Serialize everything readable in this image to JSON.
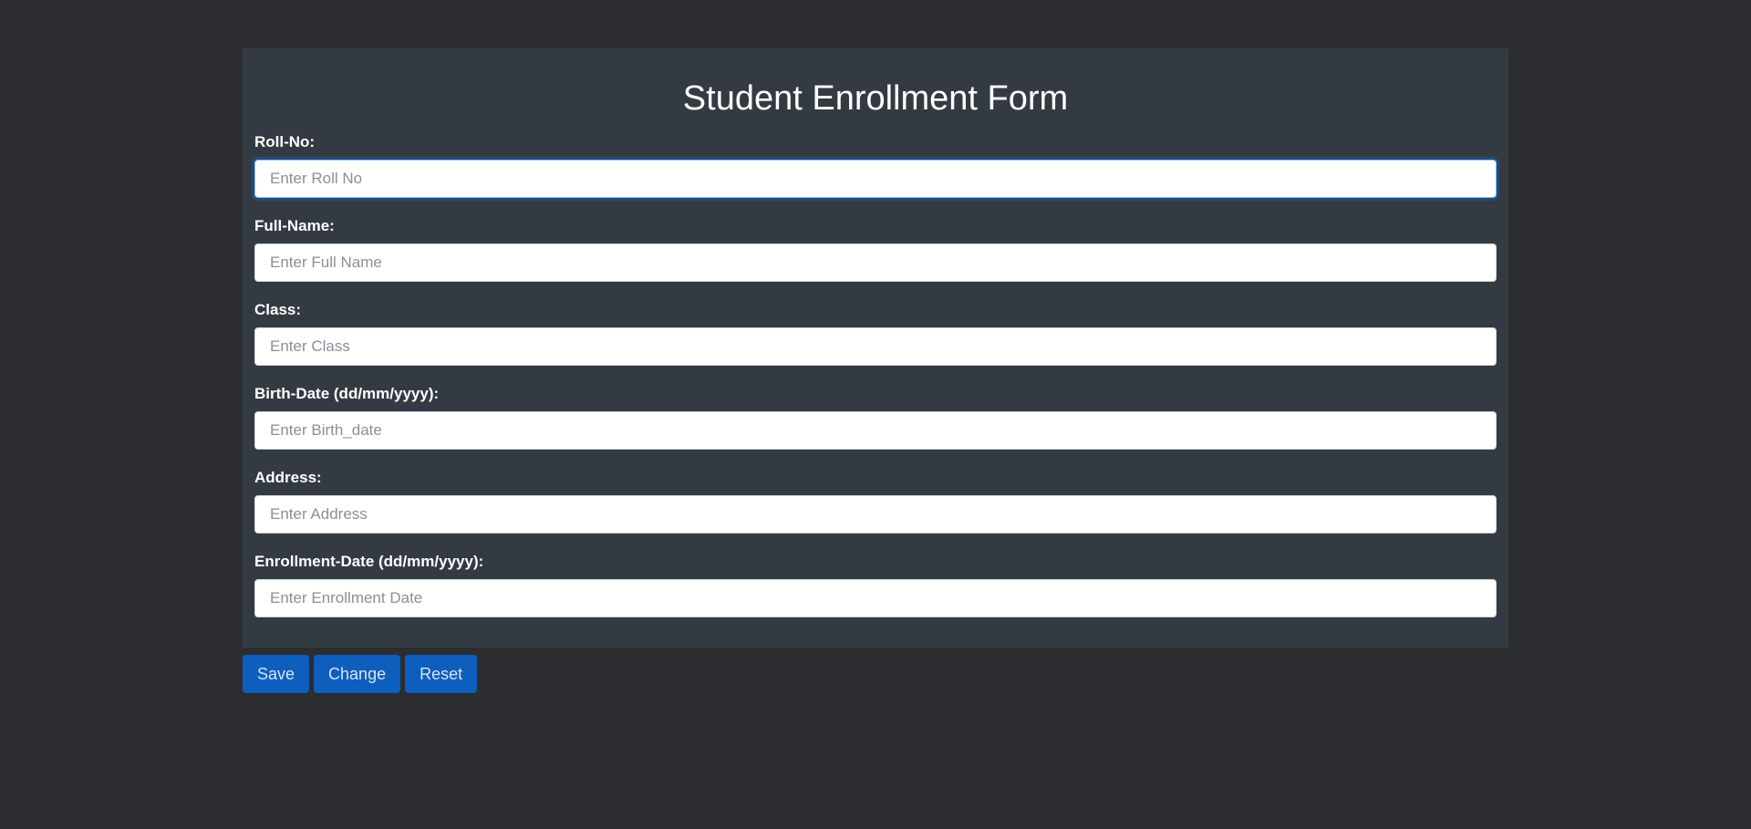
{
  "form": {
    "title": "Student Enrollment Form",
    "fields": [
      {
        "label": "Roll-No:",
        "placeholder": "Enter Roll No",
        "value": ""
      },
      {
        "label": "Full-Name:",
        "placeholder": "Enter Full Name",
        "value": ""
      },
      {
        "label": "Class:",
        "placeholder": "Enter Class",
        "value": ""
      },
      {
        "label": "Birth-Date (dd/mm/yyyy):",
        "placeholder": "Enter Birth_date",
        "value": ""
      },
      {
        "label": "Address:",
        "placeholder": "Enter Address",
        "value": ""
      },
      {
        "label": "Enrollment-Date (dd/mm/yyyy):",
        "placeholder": "Enter Enrollment Date",
        "value": ""
      }
    ]
  },
  "buttons": {
    "save_label": "Save",
    "change_label": "Change",
    "reset_label": "Reset"
  },
  "colors": {
    "page_background": "#2b2d31",
    "panel_background": "#343a42",
    "button_primary": "#0d5ebd",
    "focus_border": "#80bdff"
  }
}
